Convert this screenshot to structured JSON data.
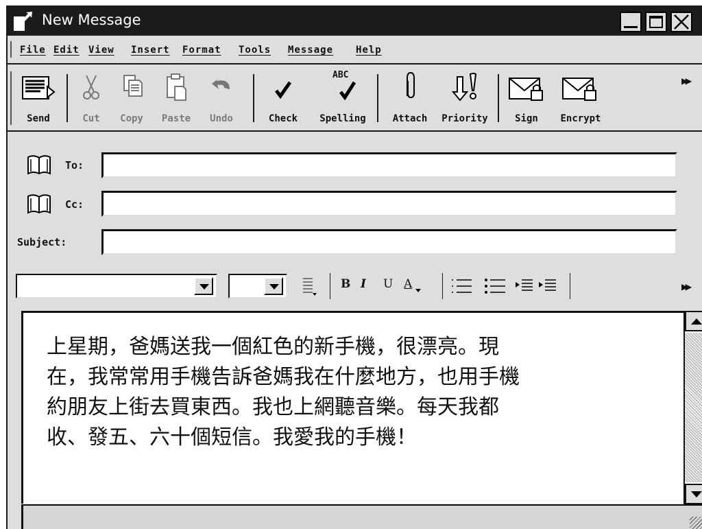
{
  "window": {
    "title": "New Message"
  },
  "menu": [
    "File",
    "Edit",
    "View",
    "Insert",
    "Format",
    "Tools",
    "Message",
    "Help"
  ],
  "toolbar": {
    "send": "Send",
    "cut": "Cut",
    "copy": "Copy",
    "paste": "Paste",
    "undo": "Undo",
    "check": "Check",
    "spelling": "Spelling",
    "attach": "Attach",
    "priority": "Priority",
    "sign": "Sign",
    "encrypt": "Encrypt",
    "spelling_badge": "ABC"
  },
  "fields": {
    "to_label": "To:",
    "to_value": "",
    "cc_label": "Cc:",
    "cc_value": "",
    "subject_label": "Subject:",
    "subject_value": ""
  },
  "format": {
    "font_value": "",
    "size_value": "",
    "bold": "B",
    "italic": "I",
    "underline": "U",
    "color": "A"
  },
  "body": {
    "text": "上星期，爸媽送我一個紅色的新手機，很漂亮。現\n在，我常常用手機告訴爸媽我在什麼地方，也用手機\n約朋友上街去買東西。我也上網聽音樂。每天我都\n收、發五、六十個短信。我愛我的手機！"
  },
  "colors": {
    "titlebar": "#1c1c1c",
    "chrome": "#dedede",
    "body_bg": "#ffffff"
  }
}
